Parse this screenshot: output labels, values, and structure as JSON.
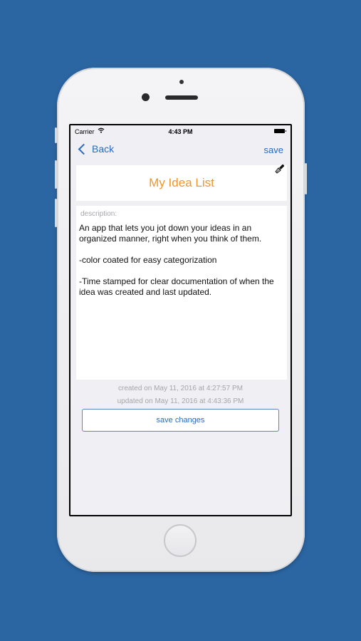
{
  "status_bar": {
    "carrier": "Carrier",
    "wifi_icon": "wifi-icon",
    "time": "4:43 PM",
    "battery_icon": "battery-icon"
  },
  "nav": {
    "back_label": "Back",
    "save_label": "save"
  },
  "idea": {
    "title": "My Idea List",
    "brush_icon": "paintbrush-icon",
    "description_label": "description:",
    "description": "An app that lets you jot down your ideas in an organized manner, right when you think of them.\n\n-color coated for easy categorization\n\n-Time stamped for clear documentation of when the idea was created and last updated."
  },
  "meta": {
    "created": "created on May 11, 2016 at 4:27:57 PM",
    "updated": "updated on May 11, 2016 at 4:43:36 PM"
  },
  "actions": {
    "save_changes_label": "save changes"
  },
  "colors": {
    "background": "#2b66a3",
    "accent_blue": "#2a6bbf",
    "title_orange": "#f0962a"
  }
}
